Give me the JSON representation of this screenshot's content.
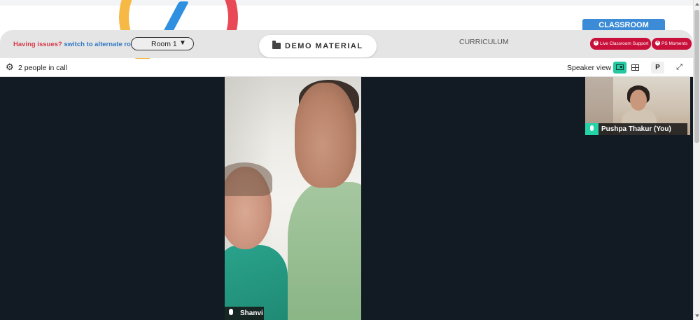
{
  "header": {
    "issues_text": "Having issues?",
    "alternate_text": "switch to alternate room",
    "room_select_value": "Room 1",
    "demo_material_label": "DEMO MATERIAL",
    "curriculum_label": "CURRICULUM",
    "classroom_tab": "CLASSROOM",
    "live_support_label": "Live Classroom Support",
    "ps_moments_label": "PS Moments"
  },
  "callbar": {
    "people_count": "2 people in call",
    "view_label": "Speaker view",
    "p_button": "P"
  },
  "participants": {
    "main_name": "Shanvi",
    "self_name": "Pushpa Thakur (You)"
  },
  "colors": {
    "accent_red": "#c8103a",
    "accent_teal": "#25c8a0",
    "classroom_blue": "#3b8bd6"
  },
  "icons": [
    "settings-gear-icon",
    "folder-icon",
    "close-circle-icon",
    "speaker-view-icon",
    "grid-view-icon",
    "expand-icon",
    "microphone-icon"
  ]
}
